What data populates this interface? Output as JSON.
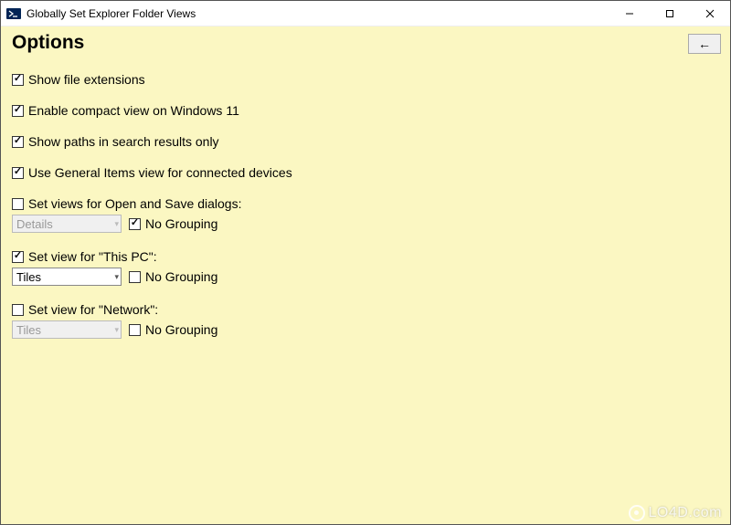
{
  "window": {
    "title": "Globally Set Explorer Folder Views"
  },
  "page": {
    "heading": "Options",
    "back_glyph": "←"
  },
  "options": {
    "show_extensions": {
      "label": "Show file extensions",
      "checked": true
    },
    "compact_view": {
      "label": "Enable compact view on Windows 11",
      "checked": true
    },
    "paths_in_search": {
      "label": "Show paths in search results only",
      "checked": true
    },
    "general_items": {
      "label": "Use General Items view for connected devices",
      "checked": true
    },
    "open_save": {
      "label": "Set views for Open and Save dialogs:",
      "checked": false,
      "select_value": "Details",
      "no_grouping_label": "No Grouping",
      "no_grouping_checked": true
    },
    "this_pc": {
      "label": "Set view for \"This PC\":",
      "checked": true,
      "select_value": "Tiles",
      "no_grouping_label": "No Grouping",
      "no_grouping_checked": false
    },
    "network": {
      "label": "Set view for \"Network\":",
      "checked": false,
      "select_value": "Tiles",
      "no_grouping_label": "No Grouping",
      "no_grouping_checked": false
    }
  },
  "watermark": {
    "text": "LO4D.com"
  }
}
